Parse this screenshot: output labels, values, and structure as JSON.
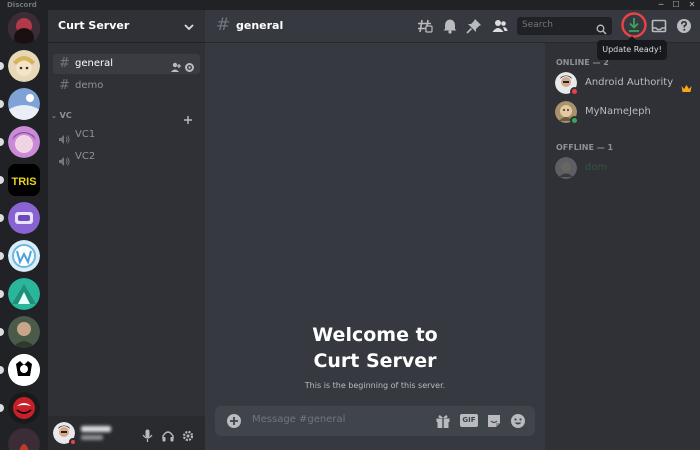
{
  "app": {
    "name": "Discord"
  },
  "window_controls": {
    "minimize": "─",
    "maximize": "☐",
    "close": "✕"
  },
  "server": {
    "name": "Curt Server"
  },
  "channels": {
    "text": [
      {
        "name": "general",
        "active": true
      },
      {
        "name": "demo",
        "active": false
      }
    ],
    "voice_category": "VC",
    "voice": [
      {
        "name": "VC1"
      },
      {
        "name": "VC2"
      }
    ]
  },
  "header": {
    "channel_name": "general",
    "search_placeholder": "Search",
    "update_tooltip": "Update Ready!"
  },
  "welcome": {
    "line1": "Welcome to",
    "line2": "Curt Server",
    "subtitle": "This is the beginning of this server."
  },
  "composer": {
    "placeholder": "Message #general",
    "gif_label": "GIF"
  },
  "members": {
    "online_header": "ONLINE — 2",
    "offline_header": "OFFLINE — 1",
    "online": [
      {
        "name": "Android Authority",
        "status": "dnd",
        "crown": true
      },
      {
        "name": "MyNameJeph",
        "status": "online",
        "crown": false
      }
    ],
    "offline": [
      {
        "name": "dom"
      }
    ]
  },
  "colors": {
    "accent_green": "#3ba55c",
    "highlight_red": "#ed4245",
    "crown": "#faa61a",
    "dnd": "#ed4245"
  }
}
